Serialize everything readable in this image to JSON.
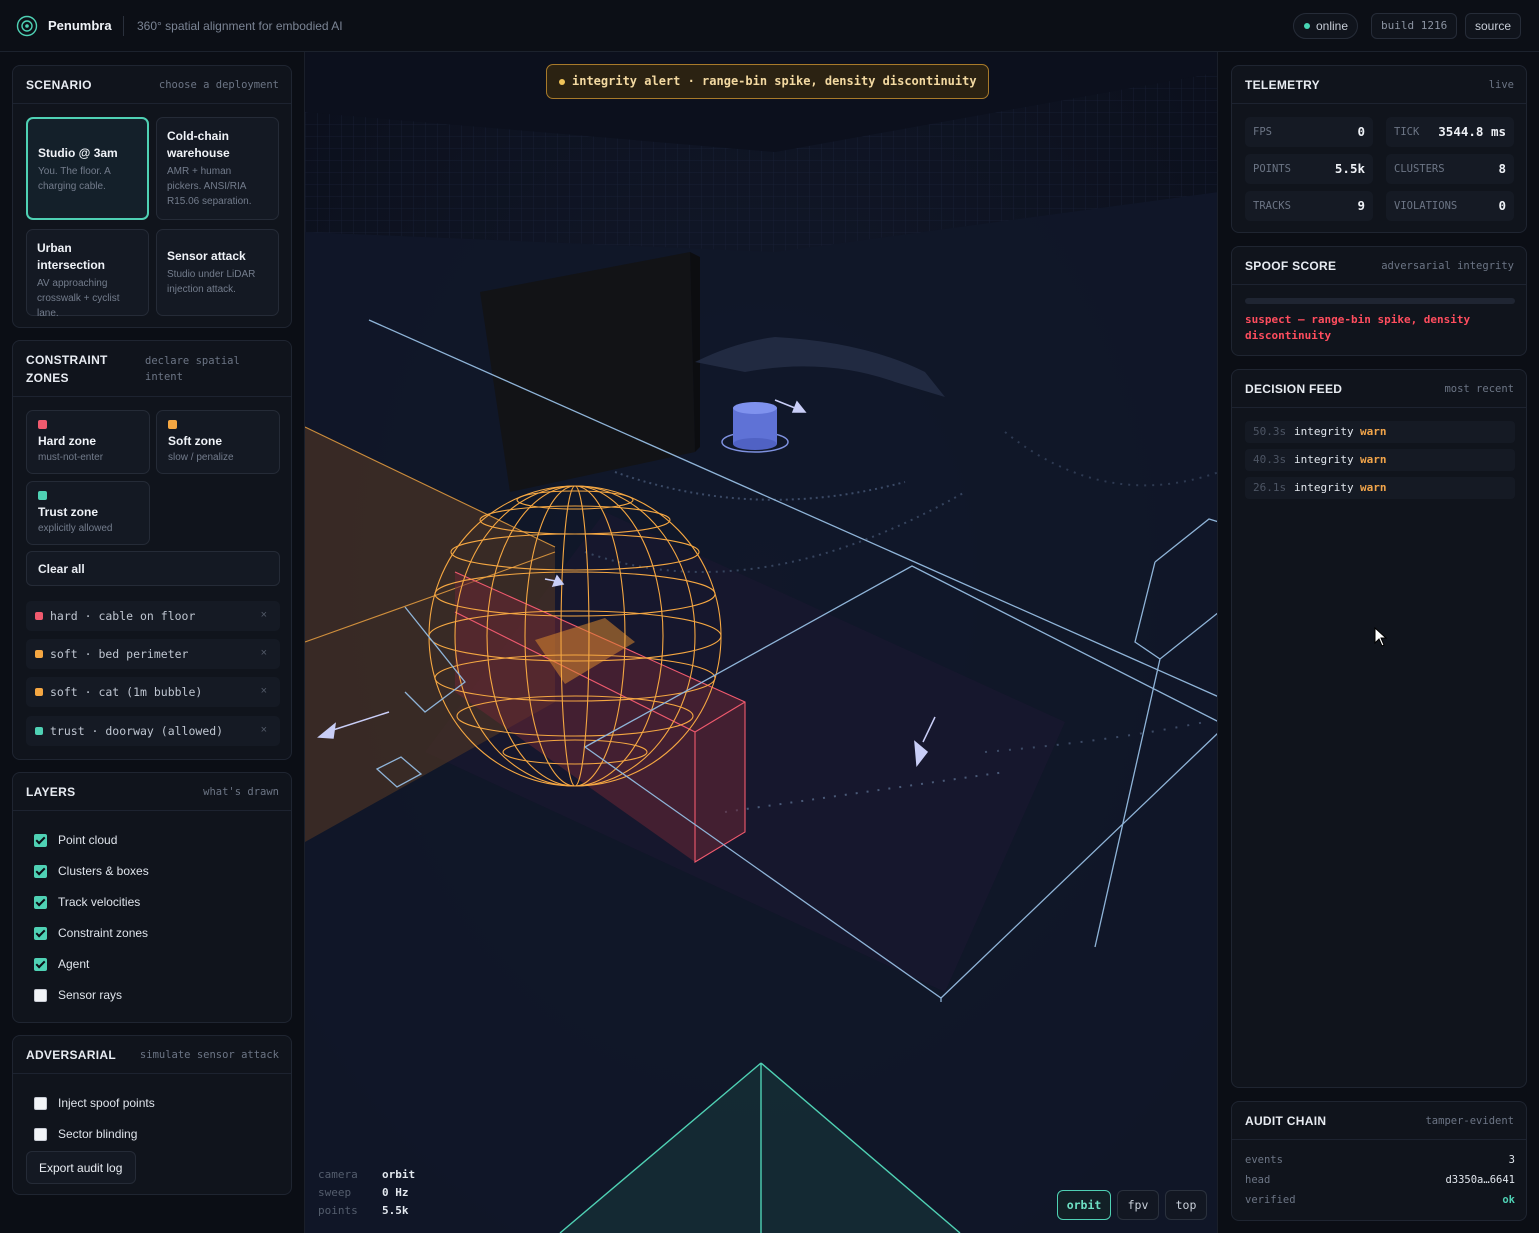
{
  "header": {
    "brand": "Penumbra",
    "tagline": "360° spatial alignment for embodied AI",
    "status": "online",
    "build": "build 1216",
    "source": "source"
  },
  "scenario": {
    "title": "SCENARIO",
    "subtitle": "choose a deployment",
    "cards": [
      {
        "title": "Studio @ 3am",
        "desc": "You. The floor. A charging cable."
      },
      {
        "title": "Cold-chain warehouse",
        "desc": "AMR + human pickers. ANSI/RIA R15.06 separation."
      },
      {
        "title": "Urban intersection",
        "desc": "AV approaching crosswalk + cyclist lane."
      },
      {
        "title": "Sensor attack",
        "desc": "Studio under LiDAR injection attack."
      }
    ]
  },
  "constraints": {
    "title": "CONSTRAINT ZONES",
    "subtitle": "declare spatial intent",
    "zone_types": [
      {
        "name": "Hard zone",
        "desc": "must-not-enter",
        "color": "#f05a6e"
      },
      {
        "name": "Soft zone",
        "desc": "slow / penalize",
        "color": "#f5a742"
      },
      {
        "name": "Trust zone",
        "desc": "explicitly allowed",
        "color": "#4fd1b4"
      }
    ],
    "clear_label": "Clear all",
    "zones": [
      {
        "text": "hard · cable on floor",
        "color": "#f05a6e"
      },
      {
        "text": "soft · bed perimeter",
        "color": "#f5a742"
      },
      {
        "text": "soft · cat (1m bubble)",
        "color": "#f5a742"
      },
      {
        "text": "trust · doorway (allowed)",
        "color": "#4fd1b4"
      }
    ],
    "remove_glyph": "×"
  },
  "layers": {
    "title": "LAYERS",
    "subtitle": "what's drawn",
    "items": [
      {
        "label": "Point cloud",
        "checked": true
      },
      {
        "label": "Clusters & boxes",
        "checked": true
      },
      {
        "label": "Track velocities",
        "checked": true
      },
      {
        "label": "Constraint zones",
        "checked": true
      },
      {
        "label": "Agent",
        "checked": true
      },
      {
        "label": "Sensor rays",
        "checked": false
      }
    ]
  },
  "adversarial": {
    "title": "ADVERSARIAL",
    "subtitle": "simulate sensor attack",
    "items": [
      {
        "label": "Inject spoof points",
        "checked": false
      },
      {
        "label": "Sector blinding",
        "checked": false
      }
    ],
    "export_label": "Export audit log"
  },
  "viewport": {
    "alert": "integrity alert · range-bin spike, density discontinuity",
    "hud": [
      {
        "key": "camera",
        "value": "orbit"
      },
      {
        "key": "sweep",
        "value": "0 Hz"
      },
      {
        "key": "points",
        "value": "5.5k"
      }
    ],
    "camera_modes": [
      "orbit",
      "fpv",
      "top"
    ],
    "active_camera": "orbit"
  },
  "telemetry": {
    "title": "TELEMETRY",
    "subtitle": "live",
    "stats": [
      {
        "key": "FPS",
        "value": "0"
      },
      {
        "key": "TICK",
        "value": "3544.8 ms"
      },
      {
        "key": "POINTS",
        "value": "5.5k"
      },
      {
        "key": "CLUSTERS",
        "value": "8"
      },
      {
        "key": "TRACKS",
        "value": "9"
      },
      {
        "key": "VIOLATIONS",
        "value": "0"
      }
    ]
  },
  "spoof": {
    "title": "SPOOF SCORE",
    "subtitle": "adversarial integrity",
    "score_fraction": 0,
    "message": "suspect — range-bin spike, density discontinuity"
  },
  "feed": {
    "title": "DECISION FEED",
    "subtitle": "most recent",
    "rows": [
      {
        "time": "50.3s",
        "channel": "integrity",
        "status": "warn"
      },
      {
        "time": "40.3s",
        "channel": "integrity",
        "status": "warn"
      },
      {
        "time": "26.1s",
        "channel": "integrity",
        "status": "warn"
      }
    ]
  },
  "audit": {
    "title": "AUDIT CHAIN",
    "subtitle": "tamper-evident",
    "rows": [
      {
        "key": "events",
        "value": "3"
      },
      {
        "key": "head",
        "value": "d3350a…6641"
      },
      {
        "key": "verified",
        "value": "ok"
      }
    ]
  },
  "colors": {
    "accent": "#4fd1b4",
    "hard": "#f05a6e",
    "soft": "#f5a742",
    "warn": "#f2a54a",
    "danger": "#ff4d5e"
  }
}
